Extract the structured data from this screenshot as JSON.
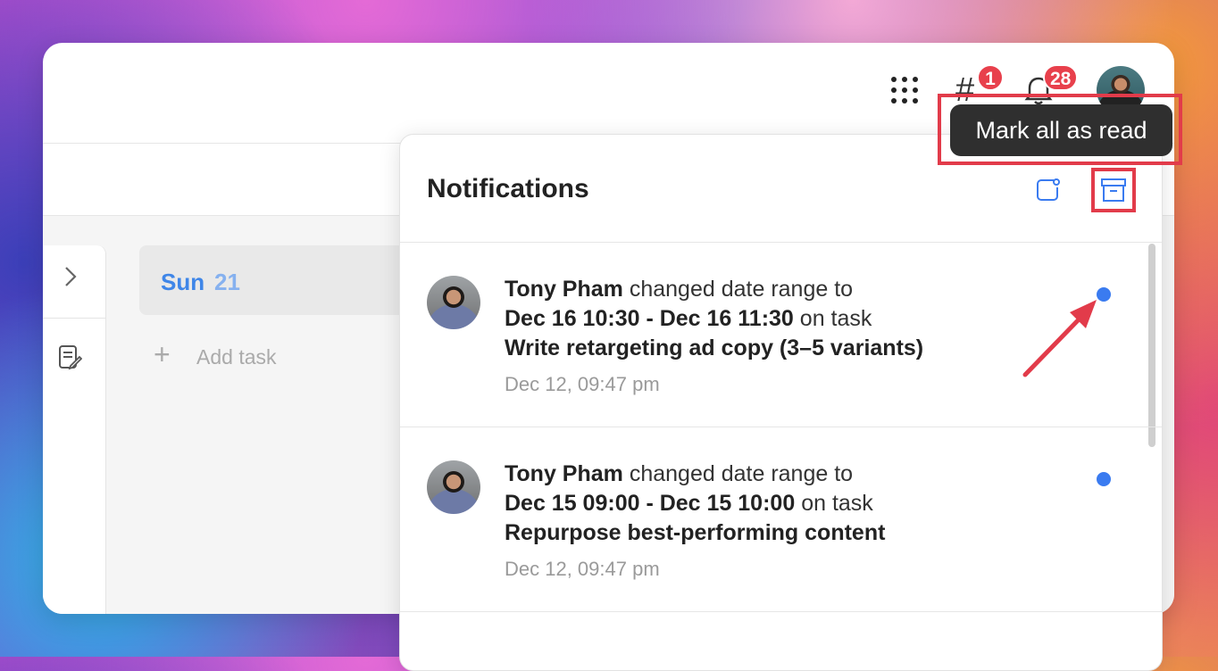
{
  "header": {
    "hash_count": "1",
    "notification_count": "28"
  },
  "tooltip": {
    "text": "Mark all as read"
  },
  "calendar": {
    "day_name": "Sun",
    "day_number": "21",
    "add_task_label": "Add task"
  },
  "notifications_panel": {
    "title": "Notifications",
    "items": [
      {
        "actor": "Tony Pham",
        "action": "changed date range to",
        "range": "Dec 16 10:30 - Dec 16 11:30",
        "on_task": "on task",
        "task": "Write retargeting ad copy (3–5 variants)",
        "time": "Dec 12, 09:47 pm",
        "unread": true
      },
      {
        "actor": "Tony Pham",
        "action": "changed date range to",
        "range": "Dec 15 09:00 - Dec 15 10:00",
        "on_task": "on task",
        "task": "Repurpose best-performing content",
        "time": "Dec 12, 09:47 pm",
        "unread": true
      }
    ]
  },
  "colors": {
    "accent_blue": "#3a7bf0",
    "badge_red": "#e8404c",
    "highlight_red": "#e23b4a"
  },
  "icons": [
    "apps-grid-icon",
    "hash-icon",
    "bell-icon",
    "chevron-right-icon",
    "note-edit-icon",
    "settings-icon",
    "archive-icon",
    "plus-icon"
  ]
}
